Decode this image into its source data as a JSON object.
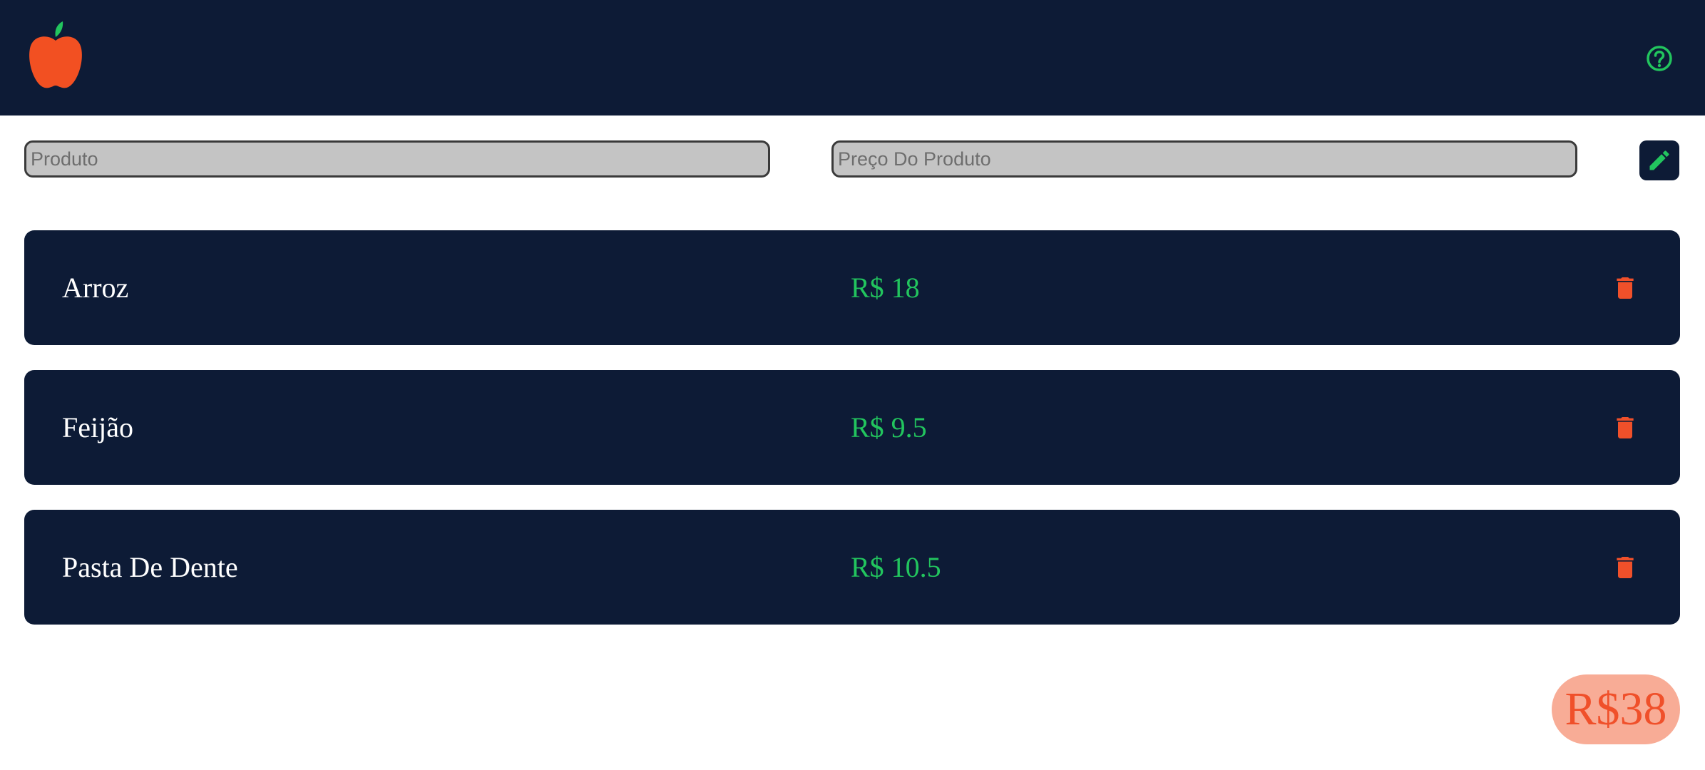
{
  "header": {
    "logo_icon": "apple-icon",
    "help_icon": "help-circle-icon"
  },
  "form": {
    "product_placeholder": "Produto",
    "price_placeholder": "Preço Do Produto",
    "submit_icon": "pencil-icon"
  },
  "items": [
    {
      "name": "Arroz",
      "price": "R$ 18",
      "delete_icon": "trash-icon"
    },
    {
      "name": "Feijão",
      "price": "R$ 9.5",
      "delete_icon": "trash-icon"
    },
    {
      "name": "Pasta De Dente",
      "price": "R$ 10.5",
      "delete_icon": "trash-icon"
    }
  ],
  "total": "R$38",
  "colors": {
    "navy": "#0d1b36",
    "green": "#22c55e",
    "orange": "#f0502a",
    "salmon": "#f8ac96",
    "input_gray": "#c4c4c4"
  }
}
